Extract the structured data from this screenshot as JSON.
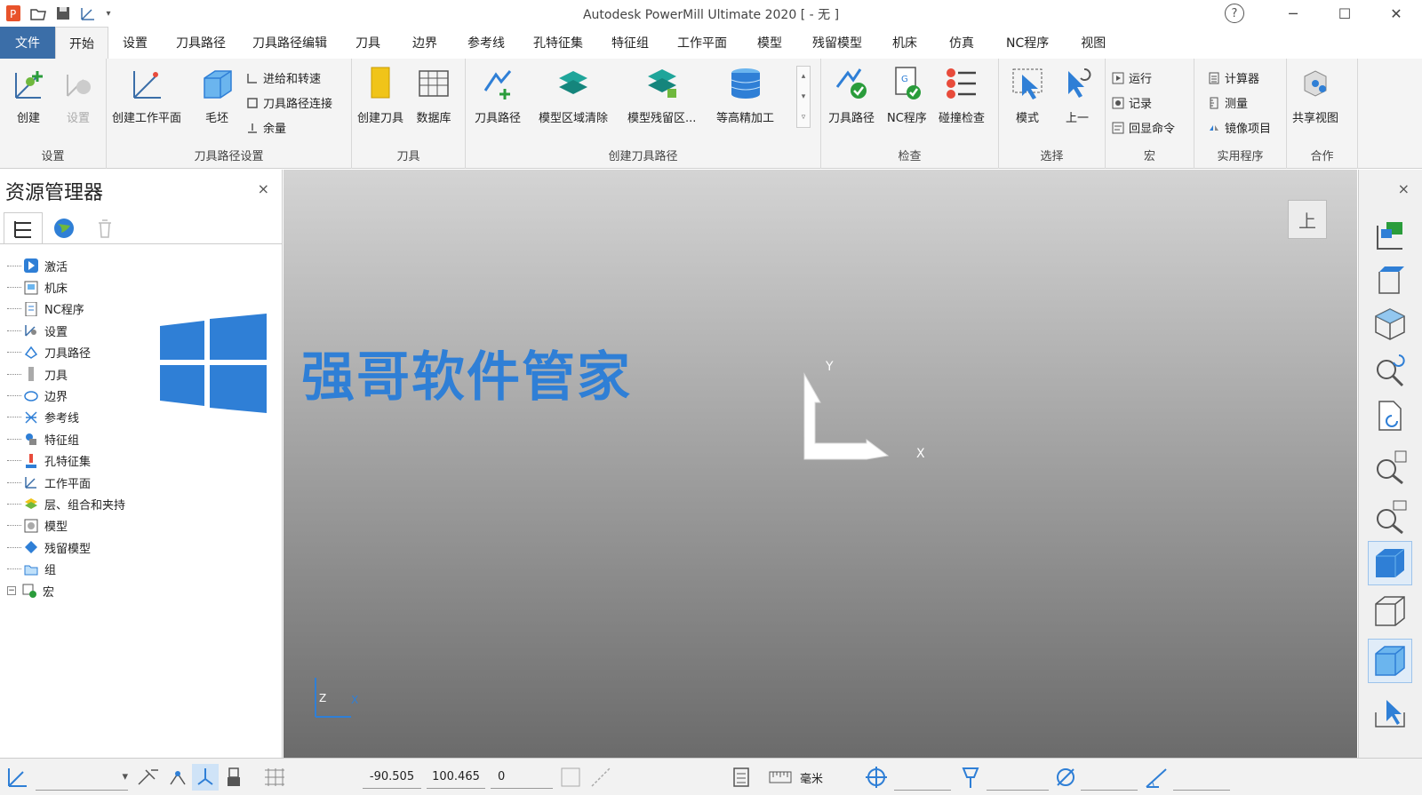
{
  "window": {
    "title": "Autodesk PowerMill Ultimate 2020   [ - 无 ]",
    "help": "?"
  },
  "menu": {
    "tabs": [
      "文件",
      "开始",
      "设置",
      "刀具路径",
      "刀具路径编辑",
      "刀具",
      "边界",
      "参考线",
      "孔特征集",
      "特征组",
      "工作平面",
      "模型",
      "残留模型",
      "机床",
      "仿真",
      "NC程序",
      "视图"
    ]
  },
  "ribbon": {
    "setup": {
      "label": "设置",
      "create": "创建",
      "setup_btn": "设置"
    },
    "toolpath_setup": {
      "label": "刀具路径设置",
      "create_workplane": "创建工作平面",
      "block": "毛坯",
      "feeds": "进给和转速",
      "connections": "刀具路径连接",
      "thickness": "余量"
    },
    "tool": {
      "label": "刀具",
      "create_tool": "创建刀具",
      "database": "数据库"
    },
    "create_toolpath": {
      "label": "创建刀具路径",
      "toolpath": "刀具路径",
      "model_area_clear": "模型区域清除",
      "model_rest": "模型残留区...",
      "constant_z": "等高精加工"
    },
    "verify": {
      "label": "检查",
      "toolpath": "刀具路径",
      "nc": "NC程序",
      "collision": "碰撞检查"
    },
    "select": {
      "label": "选择",
      "mode": "模式",
      "previous": "上一"
    },
    "macro": {
      "label": "宏",
      "run": "运行",
      "record": "记录",
      "echo": "回显命令"
    },
    "utilities": {
      "label": "实用程序",
      "calculator": "计算器",
      "measure": "测量",
      "mirror": "镜像项目"
    },
    "collab": {
      "label": "合作",
      "share": "共享视图"
    }
  },
  "explorer": {
    "title": "资源管理器",
    "close": "×",
    "items": [
      "激活",
      "机床",
      "NC程序",
      "设置",
      "刀具路径",
      "刀具",
      "边界",
      "参考线",
      "特征组",
      "孔特征集",
      "工作平面",
      "层、组合和夹持",
      "模型",
      "残留模型",
      "组",
      "宏"
    ]
  },
  "viewport": {
    "watermark": "强哥软件管家",
    "axis_y": "Y",
    "axis_x": "X",
    "small_z": "Z",
    "small_x": "X",
    "view_btn": "上"
  },
  "status": {
    "x": "-90.505",
    "y": "100.465",
    "z": "0",
    "units": "毫米"
  },
  "colors": {
    "accent": "#3b6ea8",
    "watermark": "#2f7fd6"
  }
}
